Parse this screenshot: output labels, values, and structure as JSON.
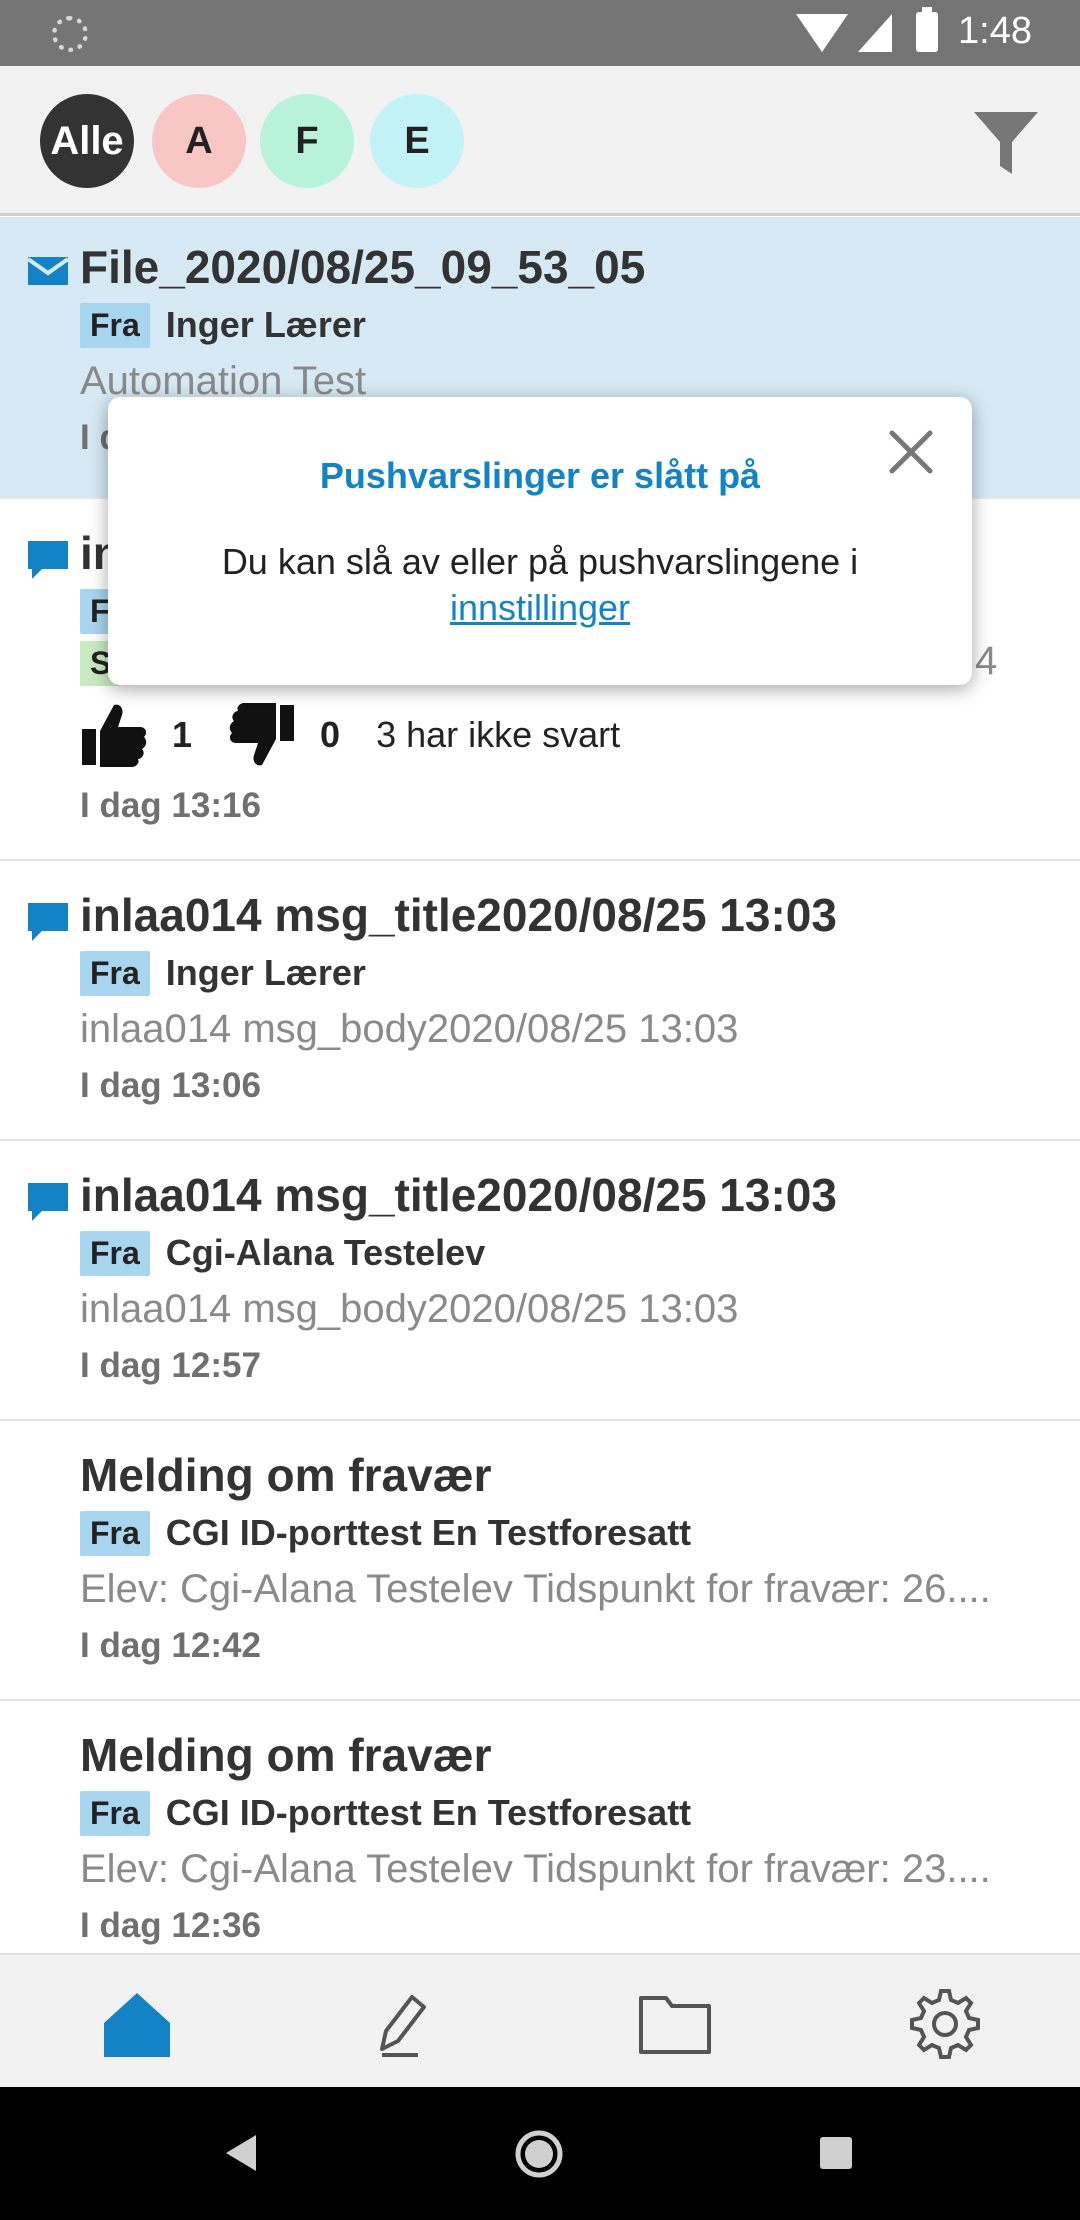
{
  "status_bar": {
    "time": "1:48",
    "icons": [
      "loading-icon",
      "wifi-icon",
      "signal-icon",
      "battery-icon"
    ]
  },
  "filters": {
    "chips": [
      {
        "label": "Alle",
        "color": "#333333",
        "selected": true
      },
      {
        "label": "A",
        "color": "#f9c6c6"
      },
      {
        "label": "F",
        "color": "#b9f3dc"
      },
      {
        "label": "E",
        "color": "#c3f3f7"
      }
    ],
    "filter_icon": "filter-icon"
  },
  "messages": [
    {
      "icon": "envelope-icon",
      "title": "File_2020/08/25_09_53_05",
      "from_tag": "Fra",
      "sender": "Inger Lærer",
      "body": "Automation Test",
      "date": "I d",
      "highlighted": true
    },
    {
      "icon": "chat-icon",
      "title": "in",
      "from_tag": "F",
      "row3_tag": "S",
      "row3_tail": "4",
      "likes": "1",
      "dislikes": "0",
      "vote_status": "3 har ikke svart",
      "date": "I dag 13:16"
    },
    {
      "icon": "chat-icon",
      "title": "inlaa014 msg_title2020/08/25 13:03",
      "from_tag": "Fra",
      "sender": "Inger Lærer",
      "body": "inlaa014 msg_body2020/08/25 13:03",
      "date": "I dag 13:06"
    },
    {
      "icon": "chat-icon",
      "title": "inlaa014 msg_title2020/08/25 13:03",
      "from_tag": "Fra",
      "sender": "Cgi-Alana Testelev",
      "body": "inlaa014 msg_body2020/08/25 13:03",
      "date": "I dag 12:57"
    },
    {
      "title": "Melding om fravær",
      "from_tag": "Fra",
      "sender": "CGI ID-porttest En Testforesatt",
      "body": "Elev: Cgi-Alana Testelev Tidspunkt for fravær: 26....",
      "date": "I dag 12:42"
    },
    {
      "title": "Melding om fravær",
      "from_tag": "Fra",
      "sender": "CGI ID-porttest En Testforesatt",
      "body": "Elev: Cgi-Alana Testelev Tidspunkt for fravær: 23....",
      "date": "I dag 12:36"
    }
  ],
  "popup": {
    "title": "Pushvarslinger er slått på",
    "text": "Du kan slå av eller på pushvarslingene i",
    "link": "innstillinger",
    "close_icon": "close-icon"
  },
  "bottom_nav": {
    "items": [
      "home-icon",
      "compose-icon",
      "folder-icon",
      "settings-icon"
    ],
    "active": "home-icon",
    "accent": "#1383c5"
  },
  "colors": {
    "accent": "#1383c5",
    "highlight_bg": "#d6e9f5",
    "fra_tag_bg": "#a9d6ef"
  }
}
